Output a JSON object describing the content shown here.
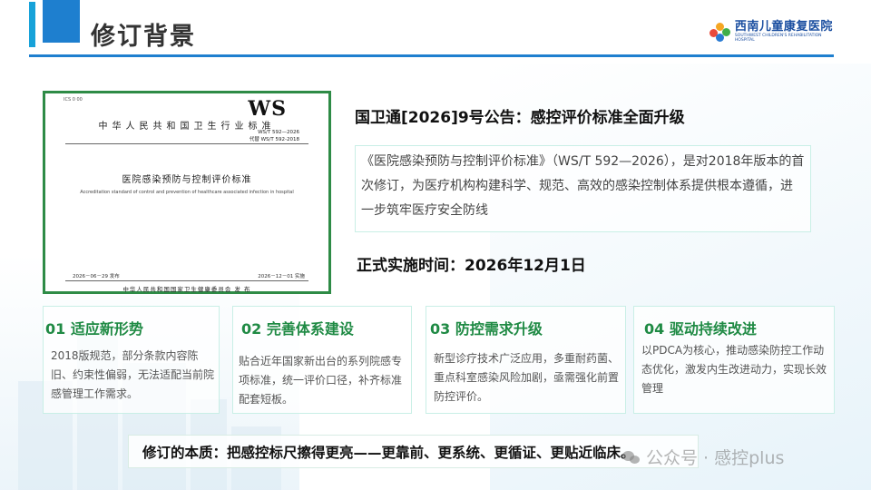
{
  "header": {
    "title": "修订背景",
    "logo": {
      "cn_name": "西南儿童康复医院",
      "en_name": "SOUTHWEST CHILDREN'S REHABILITATION HOSPITAL"
    }
  },
  "document": {
    "top_code": "ICS 0 00",
    "ws_mark": "WS",
    "standard_type": "中华人民共和国卫生行业标准",
    "code_lines": [
      "WS/T 592—2026",
      "代替 WS/T 592-2018"
    ],
    "name_cn": "医院感染预防与控制评价标准",
    "name_en": "Accreditation standard of control and prevention of healthcare associated infection in hospital",
    "publish_date": "2026－06－29 发布",
    "effective_date": "2026－12－01 实施",
    "issuer": "中华人民共和国国家卫生健康委员会  发 布"
  },
  "announcement": {
    "title": "国卫通[2026]9号公告：感控评价标准全面升级",
    "intro": "《医院感染预防与控制评价标准》（WS/T 592—2026），是对2018年版本的首次修订，为医疗机构构建科学、规范、高效的感染控制体系提供根本遵循，进一步筑牢医疗安全防线",
    "effective": "正式实施时间：2026年12月1日"
  },
  "cards": [
    {
      "title": "01 适应新形势",
      "body": "2018版规范，部分条款内容陈旧、约束性偏弱，无法适配当前院感管理工作需求。"
    },
    {
      "title": "02 完善体系建设",
      "body": "贴合近年国家新出台的系列院感专项标准，统一评价口径，补齐标准配套短板。"
    },
    {
      "title": "03 防控需求升级",
      "body": "新型诊疗技术广泛应用，多重耐药菌、重点科室感染风险加剧，亟需强化前置防控评价。"
    },
    {
      "title": "04 驱动持续改进",
      "body": "以PDCA为核心，推动感染防控工作动态优化，激发内生改进动力，实现长效管理"
    }
  ],
  "essence": "修订的本质：把感控标尺擦得更亮——更靠前、更系统、更循证、更贴近临床。",
  "watermark": "公众号 · 感控plus",
  "colors": {
    "accent_blue": "#1e7fcf",
    "green_title": "#1f8a44",
    "doc_border": "#2e8b46"
  }
}
